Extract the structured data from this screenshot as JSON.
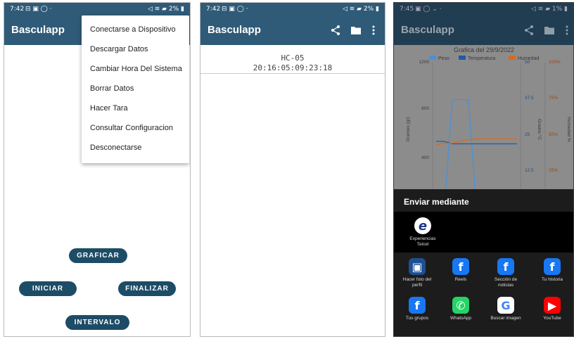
{
  "screen1": {
    "status": {
      "time": "7:42",
      "indicators": "⊟ ▣ ◯ ·",
      "system": "◁ ≋ ▰ 2% ▮"
    },
    "app_title": "Basculapp",
    "menu_items": [
      "Conectarse a Dispositivo",
      "Descargar Datos",
      "Cambiar Hora Del Sistema",
      "Borrar Datos",
      "Hacer Tara",
      "Consultar Configuracion",
      "Desconectarse"
    ],
    "buttons": {
      "graficar": "GRAFICAR",
      "iniciar": "INICIAR",
      "finalizar": "FINALIZAR",
      "intervalo": "INTERVALO"
    }
  },
  "screen2": {
    "status": {
      "time": "7:42",
      "indicators": "⊟ ▣ ◯ ·",
      "system": "◁ ≋ ▰ 2% ▮"
    },
    "app_title": "Basculapp",
    "device": {
      "name": "HC-05",
      "address": "20:16:05:09:23:18"
    }
  },
  "screen3": {
    "status": {
      "time": "7:45",
      "indicators": "▣ ◯ ⌄ ·",
      "system": "◁ ≋ ▰ 1% ▮"
    },
    "app_title": "Basculapp",
    "share_title": "Enviar mediante",
    "top_app": {
      "label_line1": "Experiencias",
      "label_line2": "Telcel",
      "color": "#ffffff",
      "letter": "e"
    },
    "apps": [
      {
        "label_line1": "Hacer foto del",
        "label_line2": "perfil",
        "color": "#1e4f93",
        "letter": "▣",
        "icon": "facebook-profile-photo-icon"
      },
      {
        "label_line1": "Reels",
        "label_line2": "",
        "color": "#1877f2",
        "letter": "f",
        "icon": "facebook-icon"
      },
      {
        "label_line1": "Sección de",
        "label_line2": "noticias",
        "color": "#1877f2",
        "letter": "f",
        "icon": "facebook-icon"
      },
      {
        "label_line1": "Tu historia",
        "label_line2": "",
        "color": "#1877f2",
        "letter": "f",
        "icon": "facebook-icon"
      },
      {
        "label_line1": "Tus grupos",
        "label_line2": "",
        "color": "#1877f2",
        "letter": "f",
        "icon": "facebook-icon"
      },
      {
        "label_line1": "WhatsApp",
        "label_line2": "",
        "color": "#25d366",
        "letter": "✆",
        "icon": "whatsapp-icon"
      },
      {
        "label_line1": "Buscar imagen",
        "label_line2": "",
        "color": "#ffffff",
        "letter": "G",
        "icon": "google-icon"
      },
      {
        "label_line1": "YouTube",
        "label_line2": "",
        "color": "#ff0000",
        "letter": "▶",
        "icon": "youtube-icon"
      }
    ],
    "chart_data": {
      "type": "line",
      "title": "Grafica del 29/9/2022",
      "legend": [
        "Peso",
        "Temperatura",
        "Humedad"
      ],
      "legend_placement": "top",
      "colors": {
        "Peso": "#4a90d9",
        "Temperatura": "#1f5ba8",
        "Humedad": "#d9691f"
      },
      "ylabel_left": "Gramos (gr)",
      "ylabel_right1": "Grados °C",
      "ylabel_right2": "Humedad %",
      "y_left_ticks": [
        "1200",
        "800",
        "400"
      ],
      "y_right1_ticks": [
        "50",
        "37.5",
        "25",
        "12.5"
      ],
      "y_right2_ticks": [
        "100%",
        "75%",
        "50%",
        "25%"
      ],
      "ylim_left": [
        0,
        1200
      ],
      "series": [
        {
          "name": "Peso",
          "x": [
            0,
            1,
            2,
            3,
            4,
            5,
            6,
            7,
            8,
            9,
            10
          ],
          "values": [
            0,
            0,
            900,
            900,
            900,
            0,
            0,
            0,
            0,
            0,
            0
          ]
        },
        {
          "name": "Temperatura",
          "x": [
            0,
            1,
            2,
            3,
            4,
            5,
            6,
            7,
            8,
            9,
            10
          ],
          "values": [
            560,
            560,
            540,
            540,
            540,
            540,
            540,
            540,
            540,
            540,
            540
          ]
        },
        {
          "name": "Humedad",
          "x": [
            0,
            1,
            2,
            3,
            4,
            5,
            6,
            7,
            8,
            9,
            10
          ],
          "values": [
            530,
            545,
            545,
            560,
            575,
            580,
            580,
            580,
            580,
            580,
            580
          ]
        }
      ]
    }
  }
}
